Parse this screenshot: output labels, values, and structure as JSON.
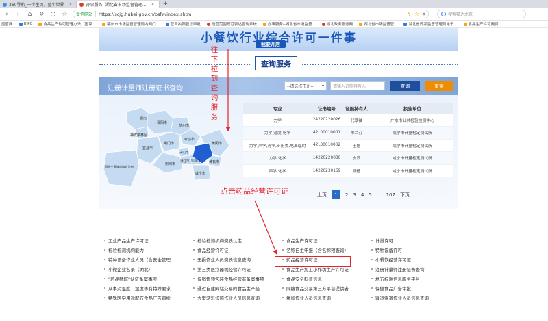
{
  "tabs": [
    {
      "label": "360导航_一个主页，整个世界",
      "active": false
    },
    {
      "label": "办事服务--湖北省市场监督管理...",
      "active": true
    }
  ],
  "nav": {
    "secure_label": "受信网站",
    "url": "https://scjg.hubei.gov.cn/bsfw/index.shtml",
    "search_placeholder": "搜索猫达北京"
  },
  "bookmarks": [
    "应官网",
    "HiPC",
    "食品生产许可管理办法（国家...",
    "鄂州市市场监督管理局内网门...",
    "营业执照登记审批",
    "经营范围规范表述查询系统",
    "办事服务--湖北省市场监督...",
    "湖北政务服务网",
    "湖北省市场监督管...",
    "湖北省药品监督管理局电子...",
    "食品生产许可网页"
  ],
  "banner": {
    "title": "小餐饮行业综合许可一件事",
    "subtitle": "我要开店"
  },
  "section": {
    "title": "查询服务"
  },
  "panel": {
    "title": "注册计量师注册证书查询",
    "city_select": "--请选择市州--",
    "input_placeholder": "请输入证照持有人",
    "query_btn": "查询",
    "reset_btn": "重置"
  },
  "map_labels": [
    "十堰市",
    "襄阳市",
    "随州市",
    "神农架林区",
    "孝感市",
    "宜昌市",
    "荆门市",
    "恩施土家族苗族自治州",
    "天门市",
    "荆州市",
    "潜江市",
    "仙桃市",
    "黄冈市",
    "黄石市",
    "咸宁市"
  ],
  "table": {
    "headers": [
      "专业",
      "证书编号",
      "证照持有人",
      "执业单位"
    ],
    "rows": [
      [
        "力学",
        "24220220026",
        "代翠袖",
        "广水市公共检验检测中心"
      ],
      [
        "力学,温度,化学",
        "42L00010001",
        "陈兰芬",
        "咸宁市计量检定测试所"
      ],
      [
        "力学,声学,光学,专用类,电离辐射",
        "42L00010002",
        "王煜",
        "咸宁市计量检定测试所"
      ],
      [
        "力学,化学",
        "14220220030",
        "皮浪",
        "咸宁市计量检定测试所"
      ],
      [
        "声学,化学",
        "14220230169",
        "顾蓓",
        "咸宁市计量检定测试所"
      ]
    ]
  },
  "pager": {
    "prev": "上页",
    "pages": [
      "1",
      "2",
      "3",
      "4",
      "5"
    ],
    "ellipsis": "...",
    "last": "107",
    "next": "下页"
  },
  "annotations": {
    "scroll_hint": [
      "往",
      "下",
      "拉",
      "到",
      "查",
      "询",
      "服",
      "务"
    ],
    "click_hint": "点击药品经营许可证"
  },
  "links": [
    [
      "工业产品生产许可证",
      "检验检测机构资质认定",
      "食品生产许可证",
      "计量许可"
    ],
    [
      "检验检测机构能力",
      "食品经营许可证",
      "名称自主申报（含名称预查询）",
      "特种设备许可"
    ],
    [
      "特种设备作业人员（含安全管理...",
      "无损作业人员资质信息查询",
      "药品经营许可证",
      "小餐饮经营许可证"
    ],
    [
      "小微企业名录（湖北）",
      "第三类医疗器械经营许可证",
      "食品生产加工小作坊生产许可证",
      "注册计量师注册证书查询"
    ],
    [
      "\"药品赫城\"认证备案事项",
      "仅销售预包装食品经营者备案事项",
      "食品安全科普信息",
      "地方标准信息服务平台"
    ],
    [
      "从事对温度、湿度等有特殊要求...",
      "通过自建网站交易的食品生产经...",
      "网络食品交易第三方平台提供者...",
      "保健食品广告审批"
    ],
    [
      "特殊医学用途配方食品广告审批",
      "大型游乐设施作业人员信息查询",
      "氧舱作业人员信息查询",
      "客运索道作业人员信息查询"
    ]
  ],
  "colors": {
    "accent": "#1f4e9c",
    "annotation": "#e8232a",
    "reset": "#f08c00"
  }
}
